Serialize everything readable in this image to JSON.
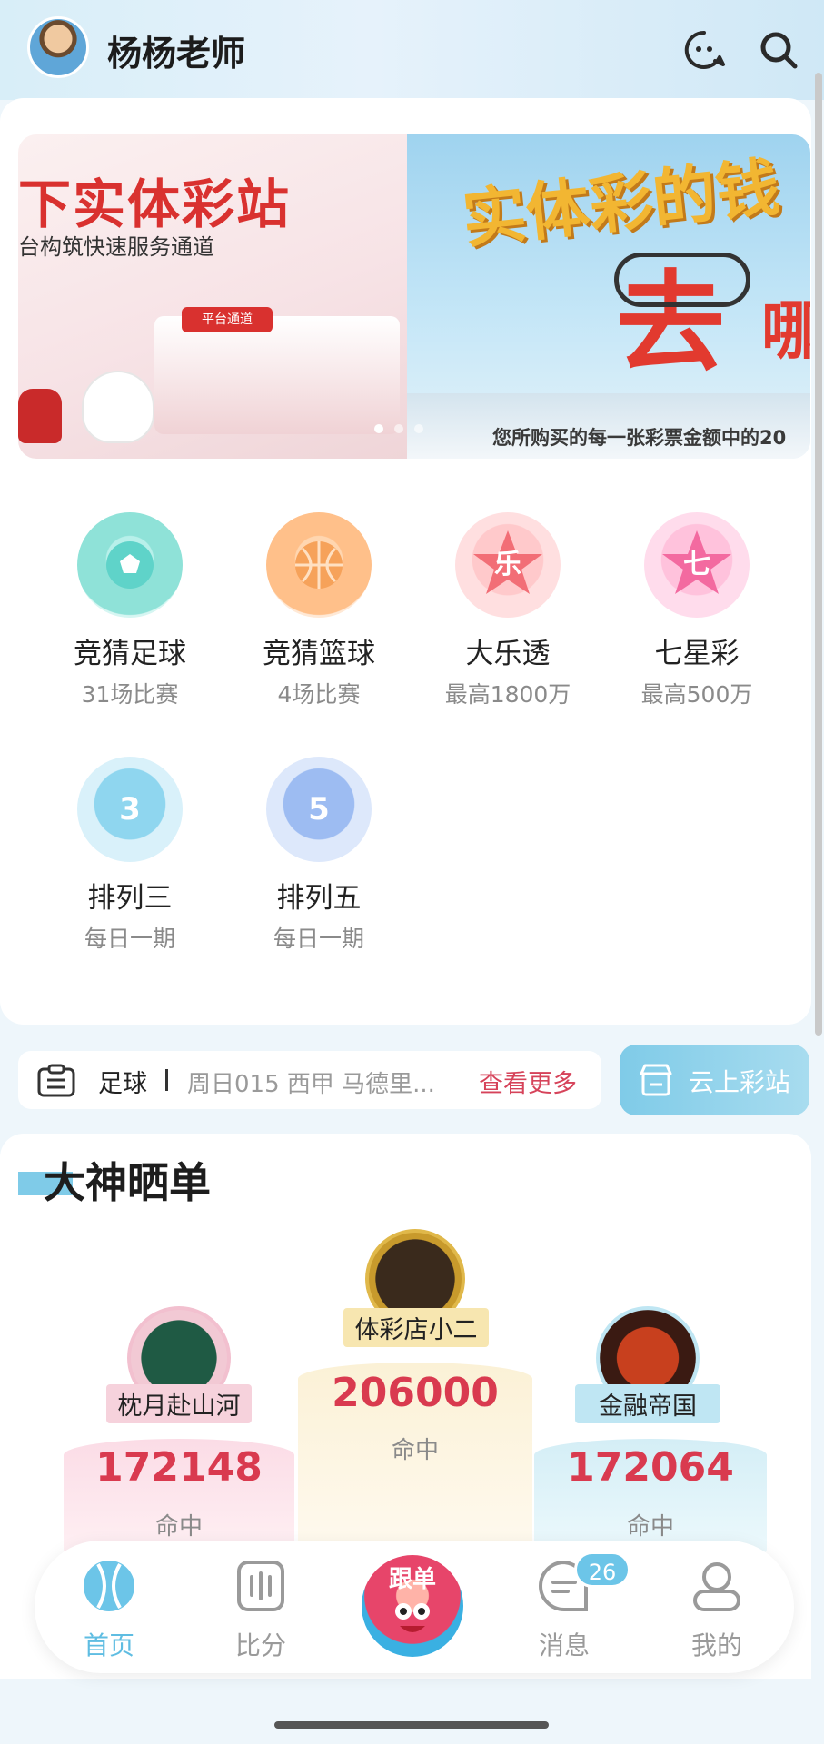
{
  "header": {
    "username": "杨杨老师",
    "icons": [
      "chat-bot-icon",
      "search-icon"
    ]
  },
  "banner": {
    "left_title": "下实体彩站",
    "left_subtitle": "台构筑快速服务通道",
    "left_sign": "平台通道",
    "right_title": "实体彩的钱",
    "right_big": "去",
    "right_small": "哪",
    "right_caption": "您所购买的每一张彩票金额中的20",
    "active_dot": 0,
    "dot_count": 3
  },
  "games": [
    {
      "name": "竞猜足球",
      "sub": "31场比赛",
      "icon": "football-icon",
      "color": "#5fd3c9"
    },
    {
      "name": "竞猜篮球",
      "sub": "4场比赛",
      "icon": "basketball-icon",
      "color": "#f6a25a"
    },
    {
      "name": "大乐透",
      "sub": "最高1800万",
      "icon": "star-le-icon",
      "color": "#f26e76",
      "glyph": "乐"
    },
    {
      "name": "七星彩",
      "sub": "最高500万",
      "icon": "star-qi-icon",
      "color": "#f36aa0",
      "glyph": "七"
    },
    {
      "name": "排列三",
      "sub": "每日一期",
      "icon": "ball-3-icon",
      "color": "#6cc6e6",
      "glyph": "3"
    },
    {
      "name": "排列五",
      "sub": "每日一期",
      "icon": "ball-5-icon",
      "color": "#7aa8ea",
      "glyph": "5"
    }
  ],
  "notice": {
    "category": "足球",
    "text": "周日015 西甲 马德里...",
    "more": "查看更多"
  },
  "cloud_store": {
    "label": "云上彩站"
  },
  "ranking": {
    "title": "大神晒单",
    "hit_label": "命中",
    "entries": [
      {
        "rank": 2,
        "name": "枕月赴山河",
        "score": "172148",
        "name_bg": "#f6d2dc",
        "podium": "#fbe3ea"
      },
      {
        "rank": 1,
        "name": "体彩店小二",
        "score": "206000",
        "name_bg": "#f7e6b0",
        "podium": "#fcf4dc"
      },
      {
        "rank": 3,
        "name": "金融帝国",
        "score": "172064",
        "name_bg": "#bfe6f3",
        "podium": "#e3f4f9"
      }
    ]
  },
  "nav": {
    "items": [
      {
        "label": "首页",
        "icon": "home-ball-icon",
        "active": true
      },
      {
        "label": "比分",
        "icon": "score-icon",
        "active": false
      },
      {
        "label": "跟单",
        "icon": "follow-mascot-icon",
        "active": false
      },
      {
        "label": "消息",
        "icon": "message-icon",
        "active": false
      },
      {
        "label": "我的",
        "icon": "profile-icon",
        "active": false
      }
    ],
    "message_badge": "26"
  },
  "colors": {
    "accent": "#5fbde2",
    "brand_red": "#d93a4f"
  }
}
